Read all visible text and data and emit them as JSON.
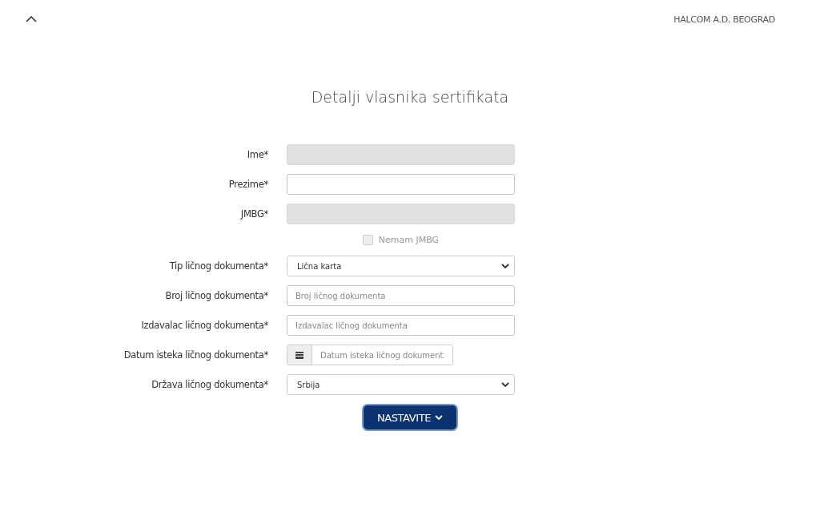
{
  "header": {
    "company": "HALCOM A.D. BEOGRAD"
  },
  "title": "Detalji vlasnika sertifikata",
  "fields": [
    {
      "kind": "text",
      "label": "Ime*",
      "disabled": true
    },
    {
      "kind": "text",
      "label": "Prezime*",
      "disabled": false
    },
    {
      "kind": "text",
      "label": "JMBG*",
      "disabled": true
    },
    {
      "kind": "checkbox",
      "text": "Nemam JMBG",
      "checked": false,
      "disabled": true
    },
    {
      "kind": "select",
      "label": "Tip ličnog dokumenta*",
      "value": "Lična karta",
      "disabled": false
    },
    {
      "kind": "text",
      "label": "Broj ličnog dokumenta*",
      "placeholder": "Broj ličnog dokumenta",
      "disabled": false
    },
    {
      "kind": "text",
      "label": "Izdavalac ličnog dokumenta*",
      "placeholder": "Izdavalac ličnog dokumenta",
      "disabled": false
    },
    {
      "kind": "date",
      "label": "Datum isteka ličnog dokumenta*",
      "placeholder": "Datum isteka ličnog dokument.",
      "disabled": false
    },
    {
      "kind": "select",
      "label": "Država ličnog dokumenta*",
      "value": "Srbija",
      "disabled": false
    }
  ],
  "button": {
    "label": "NASTAVITE"
  }
}
